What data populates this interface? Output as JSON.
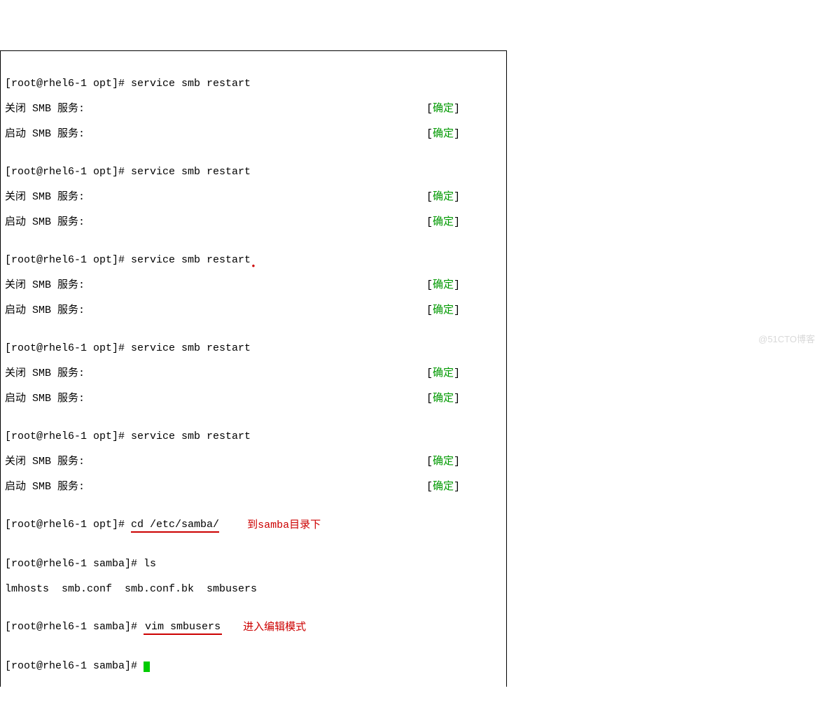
{
  "prompt_opt": "[root@rhel6-1 opt]# ",
  "prompt_samba": "[root@rhel6-1 samba]# ",
  "cmd_restart": "service smb restart",
  "msg_shutdown": "关闭 SMB 服务:",
  "msg_start": "启动 SMB 服务:",
  "status_ok": "确定",
  "bracket_open": "[",
  "bracket_close": "]",
  "cmd_cd": "cd /etc/samba/",
  "cmd_ls": "ls",
  "ls_output": "lmhosts  smb.conf  smb.conf.bk  smbusers",
  "cmd_vim": "vim smbusers",
  "annotation_cd_pre": "到",
  "annotation_cd_samba": "samba",
  "annotation_cd_post": "目录下",
  "annotation_vim": "进入编辑模式",
  "watermark": "@51CTO博客"
}
